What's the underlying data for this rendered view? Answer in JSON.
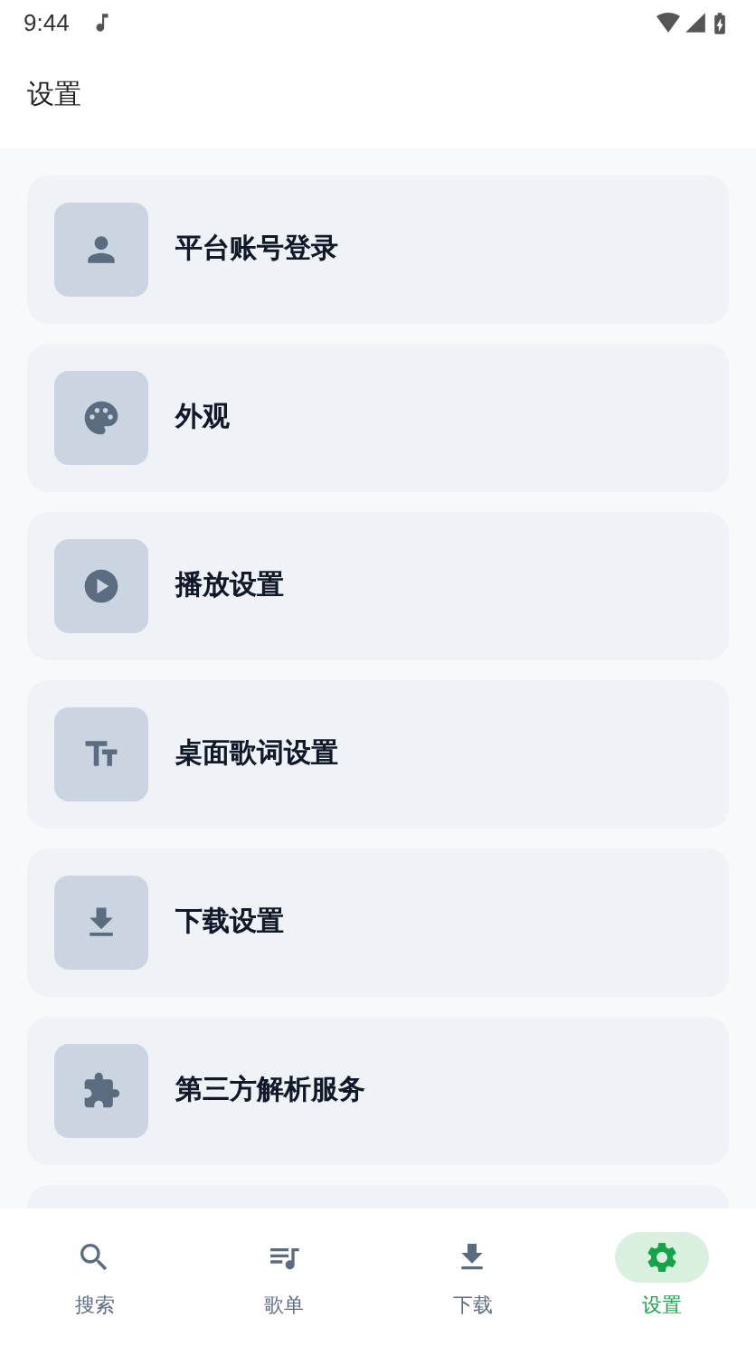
{
  "status_bar": {
    "time": "9:44"
  },
  "header": {
    "title": "设置"
  },
  "settings_items": [
    {
      "label": "平台账号登录"
    },
    {
      "label": "外观"
    },
    {
      "label": "播放设置"
    },
    {
      "label": "桌面歌词设置"
    },
    {
      "label": "下载设置"
    },
    {
      "label": "第三方解析服务"
    }
  ],
  "bottom_nav": [
    {
      "label": "搜索",
      "selected": false
    },
    {
      "label": "歌单",
      "selected": false
    },
    {
      "label": "下载",
      "selected": false
    },
    {
      "label": "设置",
      "selected": true
    }
  ]
}
